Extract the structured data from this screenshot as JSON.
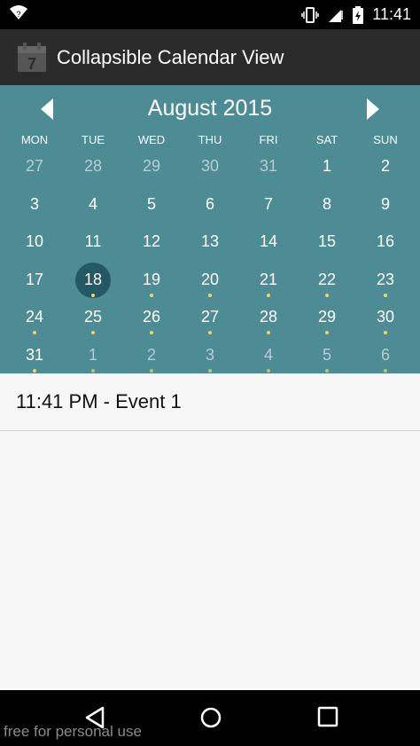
{
  "status_bar": {
    "time": "11:41",
    "icons": [
      "wifi-icon",
      "vibrate-icon",
      "signal-icon",
      "battery-icon"
    ],
    "wifi_badge": "?"
  },
  "app_bar": {
    "title": "Collapsible Calendar View",
    "icon_number": "7"
  },
  "calendar": {
    "month_title": "August 2015",
    "weekdays": [
      "MON",
      "TUE",
      "WED",
      "THU",
      "FRI",
      "SAT",
      "SUN"
    ],
    "weeks": [
      [
        {
          "day": "27",
          "other": true,
          "dot": false
        },
        {
          "day": "28",
          "other": true,
          "dot": false
        },
        {
          "day": "29",
          "other": true,
          "dot": false
        },
        {
          "day": "30",
          "other": true,
          "dot": false
        },
        {
          "day": "31",
          "other": true,
          "dot": false
        },
        {
          "day": "1",
          "other": false,
          "dot": false
        },
        {
          "day": "2",
          "other": false,
          "dot": false
        }
      ],
      [
        {
          "day": "3",
          "other": false,
          "dot": false
        },
        {
          "day": "4",
          "other": false,
          "dot": false
        },
        {
          "day": "5",
          "other": false,
          "dot": false
        },
        {
          "day": "6",
          "other": false,
          "dot": false
        },
        {
          "day": "7",
          "other": false,
          "dot": false
        },
        {
          "day": "8",
          "other": false,
          "dot": false
        },
        {
          "day": "9",
          "other": false,
          "dot": false
        }
      ],
      [
        {
          "day": "10",
          "other": false,
          "dot": false
        },
        {
          "day": "11",
          "other": false,
          "dot": false
        },
        {
          "day": "12",
          "other": false,
          "dot": false
        },
        {
          "day": "13",
          "other": false,
          "dot": false
        },
        {
          "day": "14",
          "other": false,
          "dot": false
        },
        {
          "day": "15",
          "other": false,
          "dot": false
        },
        {
          "day": "16",
          "other": false,
          "dot": false
        }
      ],
      [
        {
          "day": "17",
          "other": false,
          "dot": false
        },
        {
          "day": "18",
          "other": false,
          "dot": true,
          "selected": true
        },
        {
          "day": "19",
          "other": false,
          "dot": true
        },
        {
          "day": "20",
          "other": false,
          "dot": true
        },
        {
          "day": "21",
          "other": false,
          "dot": true
        },
        {
          "day": "22",
          "other": false,
          "dot": true
        },
        {
          "day": "23",
          "other": false,
          "dot": true
        }
      ],
      [
        {
          "day": "24",
          "other": false,
          "dot": true
        },
        {
          "day": "25",
          "other": false,
          "dot": true
        },
        {
          "day": "26",
          "other": false,
          "dot": true
        },
        {
          "day": "27",
          "other": false,
          "dot": true
        },
        {
          "day": "28",
          "other": false,
          "dot": true
        },
        {
          "day": "29",
          "other": false,
          "dot": true
        },
        {
          "day": "30",
          "other": false,
          "dot": true
        }
      ],
      [
        {
          "day": "31",
          "other": false,
          "dot": true
        },
        {
          "day": "1",
          "other": true,
          "dot": true
        },
        {
          "day": "2",
          "other": true,
          "dot": true
        },
        {
          "day": "3",
          "other": true,
          "dot": true
        },
        {
          "day": "4",
          "other": true,
          "dot": true
        },
        {
          "day": "5",
          "other": true,
          "dot": true
        },
        {
          "day": "6",
          "other": true,
          "dot": true
        }
      ]
    ]
  },
  "event": {
    "text": "11:41 PM - Event 1"
  },
  "nav_bar": {
    "icons": [
      "back-icon",
      "home-icon",
      "recent-apps-icon"
    ]
  },
  "watermark": "free for personal use",
  "colors": {
    "calendar_bg": "#4d8b95",
    "selected_circle": "#235864",
    "event_dot": "#f4d35e",
    "app_bar": "#2b2b2b"
  }
}
